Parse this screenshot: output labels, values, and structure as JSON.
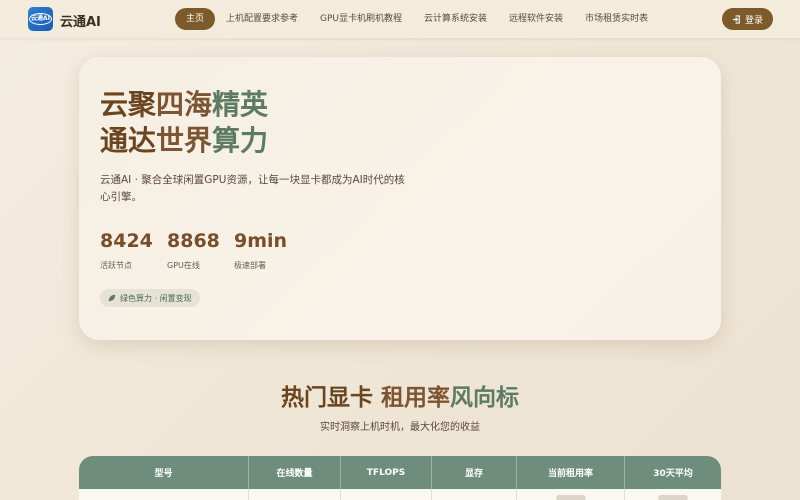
{
  "nav": {
    "logo_text": "云通AI",
    "brand": "云通AI",
    "links": [
      "主页",
      "上机配置要求参考",
      "GPU显卡机刷机教程",
      "云计算系统安装",
      "远程软件安装",
      "市场租赁实时表"
    ],
    "login": "登录"
  },
  "hero": {
    "title_line1_a": "云聚",
    "title_line1_b": "四海",
    "title_line1_c": "精英",
    "title_line2_a": "通达",
    "title_line2_b": "世界",
    "title_line2_c": "算力",
    "description": "云通AI · 聚合全球闲置GPU资源，让每一块显卡都成为AI时代的核心引擎。",
    "stats": [
      {
        "value": "8424",
        "label": "活跃节点"
      },
      {
        "value": "8868",
        "label": "GPU在线"
      },
      {
        "value": "9min",
        "label": "极速部署"
      }
    ],
    "badge": "绿色算力 · 闲置变现"
  },
  "section": {
    "title_a": "热门显卡 ",
    "title_b": "租用率",
    "title_c": "风向标",
    "subtitle": "实时洞察上机时机，最大化您的收益"
  },
  "table": {
    "headers": [
      "型号",
      "在线数量",
      "TFLOPS",
      "显存",
      "当前租用率",
      "30天平均"
    ]
  },
  "colors": {
    "accent": "#7c5a2a",
    "green": "#6e8d7c",
    "logo_blue": "#2d7fd6"
  }
}
